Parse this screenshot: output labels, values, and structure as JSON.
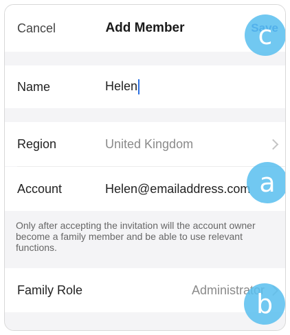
{
  "header": {
    "cancel_label": "Cancel",
    "title": "Add Member",
    "save_label": "Save"
  },
  "name_row": {
    "label": "Name",
    "value": "Helen"
  },
  "region_row": {
    "label": "Region",
    "value": "United Kingdom"
  },
  "account_row": {
    "label": "Account",
    "value": "Helen@emailaddress.com"
  },
  "note": {
    "text": "Only after accepting the invitation will the account owner become a family member and be able to use relevant functions."
  },
  "role_row": {
    "label": "Family Role",
    "value": "Administrator"
  },
  "callouts": {
    "a": "a",
    "b": "b",
    "c": "c"
  },
  "colors": {
    "accent": "#2a5fd4",
    "callout": "#58beee",
    "background": "#f4f4f6"
  }
}
